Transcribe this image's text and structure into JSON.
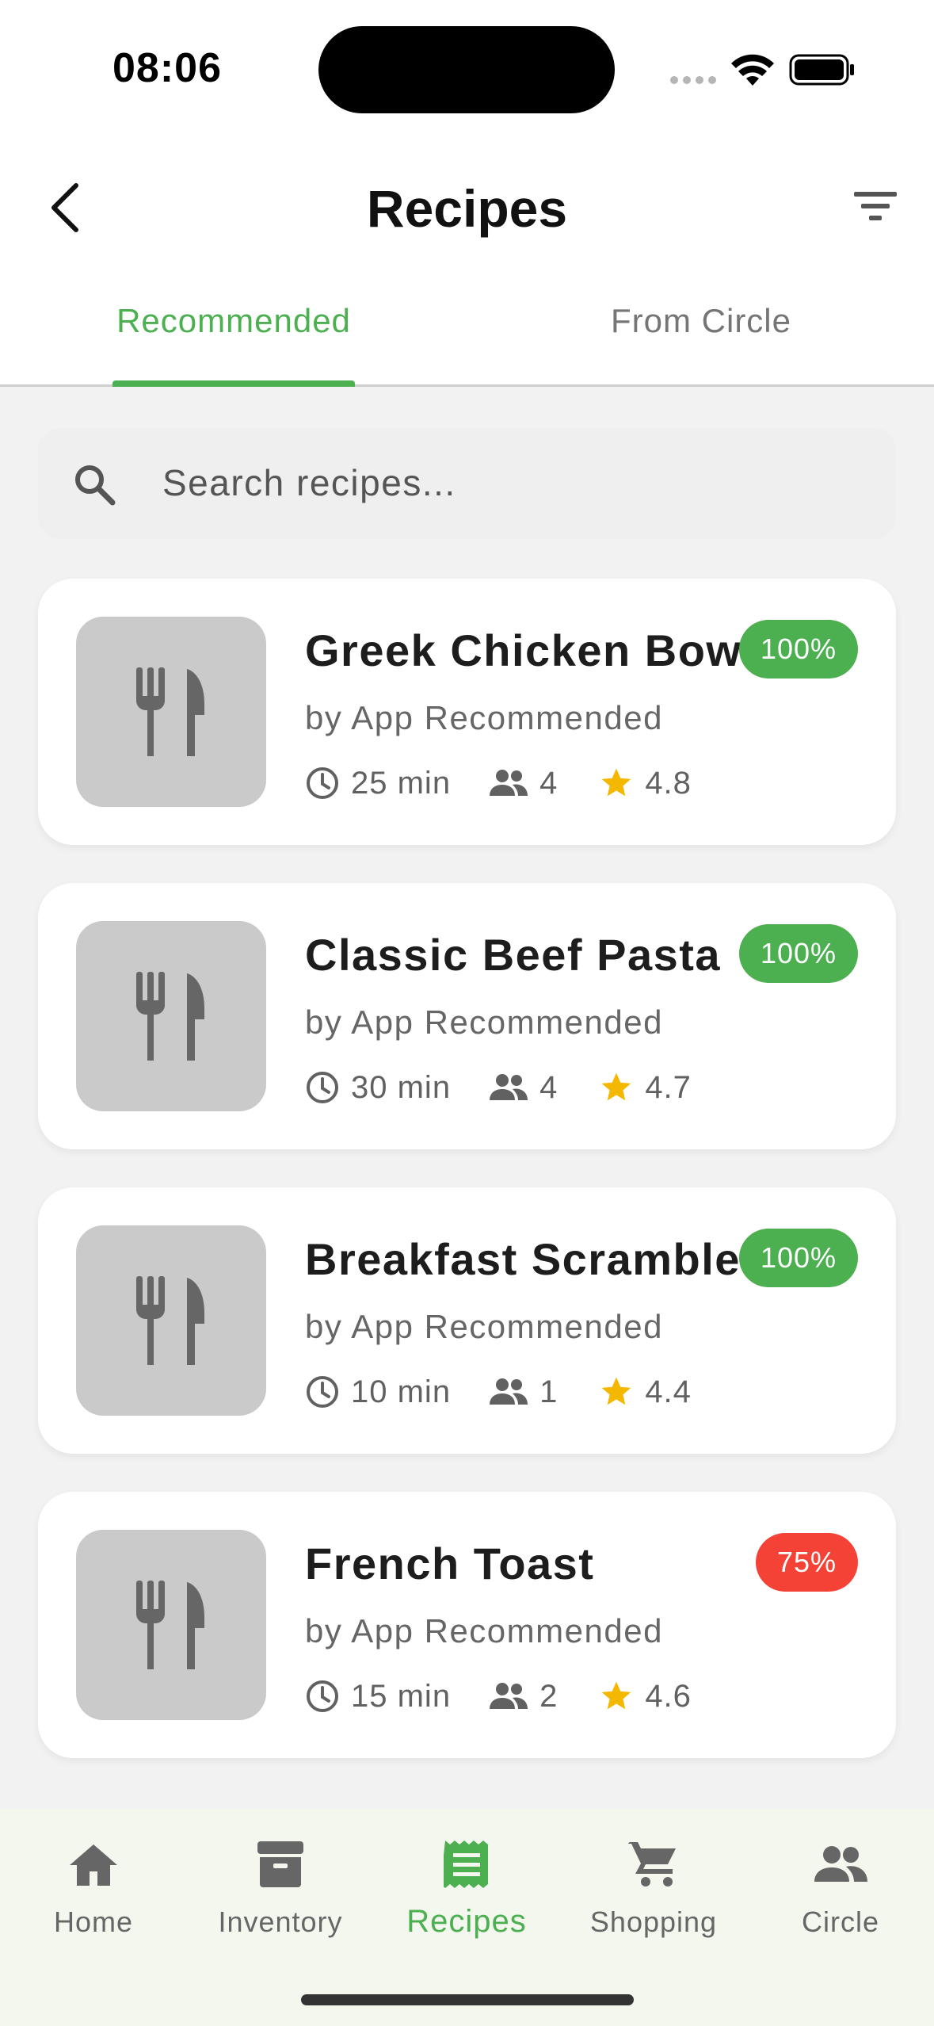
{
  "status_bar": {
    "time": "08:06"
  },
  "header": {
    "title": "Recipes",
    "back_icon": "chevron-left-icon",
    "filter_icon": "filter-icon"
  },
  "tabs": [
    {
      "label": "Recommended",
      "active": true
    },
    {
      "label": "From Circle",
      "active": false
    }
  ],
  "search": {
    "placeholder": "Search recipes..."
  },
  "recipes": [
    {
      "title": "Greek Chicken Bowl",
      "author": "by App Recommended",
      "time": "25 min",
      "servings": "4",
      "rating": "4.8",
      "match": "100%",
      "match_color": "#4caf50"
    },
    {
      "title": "Classic Beef Pasta",
      "author": "by App Recommended",
      "time": "30 min",
      "servings": "4",
      "rating": "4.7",
      "match": "100%",
      "match_color": "#4caf50"
    },
    {
      "title": "Breakfast Scramble",
      "author": "by App Recommended",
      "time": "10 min",
      "servings": "1",
      "rating": "4.4",
      "match": "100%",
      "match_color": "#4caf50"
    },
    {
      "title": "French Toast",
      "author": "by App Recommended",
      "time": "15 min",
      "servings": "2",
      "rating": "4.6",
      "match": "75%",
      "match_color": "#f44336"
    }
  ],
  "bottom_nav": [
    {
      "label": "Home",
      "icon": "home-icon",
      "active": false
    },
    {
      "label": "Inventory",
      "icon": "inventory-icon",
      "active": false
    },
    {
      "label": "Recipes",
      "icon": "recipes-icon",
      "active": true
    },
    {
      "label": "Shopping",
      "icon": "cart-icon",
      "active": false
    },
    {
      "label": "Circle",
      "icon": "people-icon",
      "active": false
    }
  ],
  "colors": {
    "accent": "#4caf50",
    "warning": "#f44336",
    "star": "#f5b800"
  }
}
